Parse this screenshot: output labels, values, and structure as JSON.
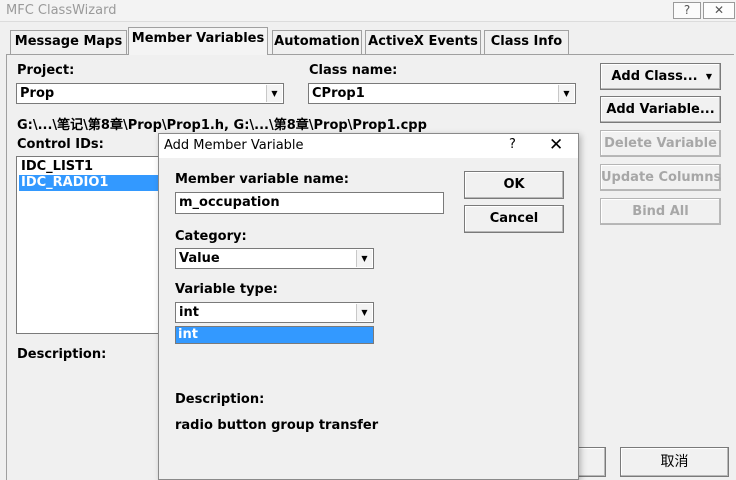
{
  "window": {
    "title": "MFC ClassWizard",
    "help_button": "?",
    "close_button": "✕"
  },
  "tabs": [
    {
      "label": "Message Maps"
    },
    {
      "label": "Member Variables"
    },
    {
      "label": "Automation"
    },
    {
      "label": "ActiveX Events"
    },
    {
      "label": "Class Info"
    }
  ],
  "project": {
    "label": "Project:",
    "value": "Prop"
  },
  "class_name": {
    "label": "Class name:",
    "value": "CProp1"
  },
  "file_path": "G:\\...\\笔记\\第8章\\Prop\\Prop1.h, G:\\...\\第8章\\Prop\\Prop1.cpp",
  "control_ids": {
    "label": "Control IDs:",
    "items": [
      "IDC_LIST1",
      "IDC_RADIO1"
    ]
  },
  "description_label": "Description:",
  "buttons": {
    "add_class": "Add Class...",
    "add_variable": "Add Variable...",
    "delete_variable": "Delete Variable",
    "update_columns": "Update Columns",
    "bind_all": "Bind All",
    "cancel_cn": "取消"
  },
  "dialog": {
    "title": "Add Member Variable",
    "help": "?",
    "close": "✕",
    "member_name_label": "Member variable name:",
    "member_name_value": "m_occupation",
    "category_label": "Category:",
    "category_value": "Value",
    "variable_type_label": "Variable type:",
    "variable_type_value": "int",
    "dropdown_options": [
      "int"
    ],
    "ok": "OK",
    "cancel": "Cancel",
    "description_label": "Description:",
    "description_text": "radio button group transfer"
  },
  "icons": {
    "combo_arrow": "▼",
    "menu_arrow": "▼"
  }
}
